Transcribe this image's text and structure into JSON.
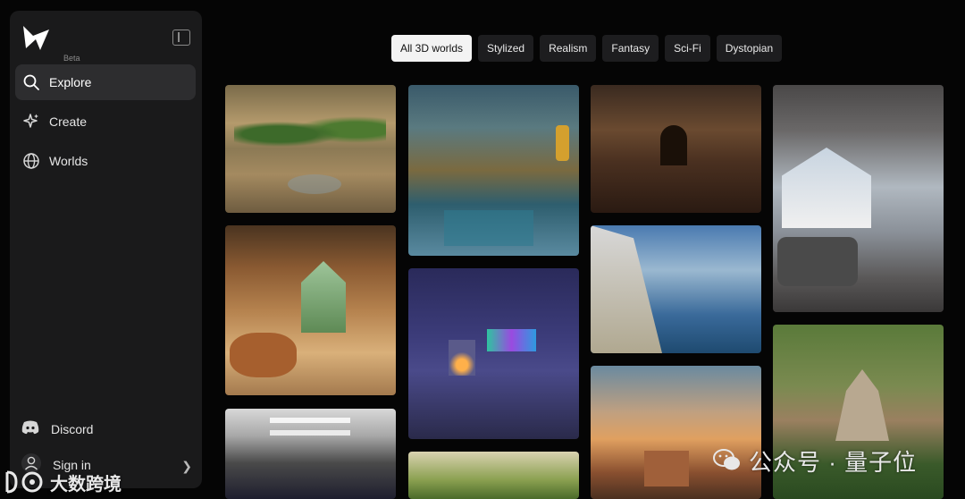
{
  "sidebar": {
    "badge": "Beta",
    "nav": [
      {
        "label": "Explore",
        "icon": "search-icon",
        "active": true
      },
      {
        "label": "Create",
        "icon": "sparkle-icon",
        "active": false
      },
      {
        "label": "Worlds",
        "icon": "globe-icon",
        "active": false
      }
    ],
    "discord_label": "Discord",
    "signin_label": "Sign in"
  },
  "filters": [
    "All 3D worlds",
    "Stylized",
    "Realism",
    "Fantasy",
    "Sci-Fi",
    "Dystopian"
  ],
  "active_filter": "All 3D worlds",
  "gallery": [
    {
      "subject": "greenhouse-atrium"
    },
    {
      "subject": "wooden-cabin-bath"
    },
    {
      "subject": "spaceship-corridor"
    },
    {
      "subject": "ornate-cathedral-hall"
    },
    {
      "subject": "aurora-igloo-lounge"
    },
    {
      "subject": "green-landscape"
    },
    {
      "subject": "stone-dungeon-corridor"
    },
    {
      "subject": "seaside-village-street"
    },
    {
      "subject": "tuscan-sunset-villa"
    },
    {
      "subject": "mountain-view-loft"
    },
    {
      "subject": "floating-castle-island"
    }
  ],
  "watermarks": {
    "right": "公众号 · 量子位",
    "left": "大数跨境"
  },
  "colors": {
    "background": "#050505",
    "sidebar": "#1a1a1b",
    "active_nav": "#2d2d2f",
    "chip": "#1d1d1f",
    "chip_active": "#f3f3f3"
  }
}
